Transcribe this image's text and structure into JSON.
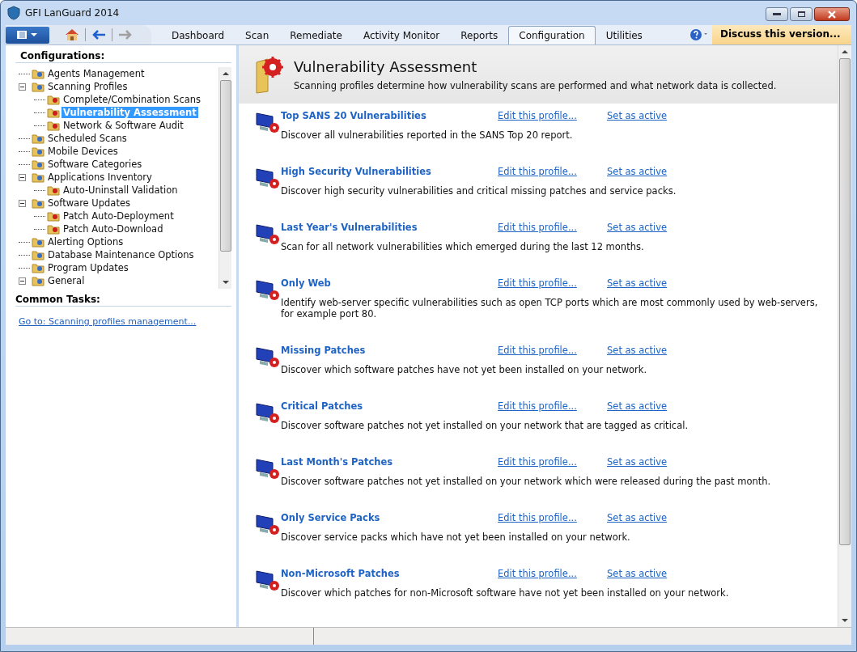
{
  "window": {
    "title": "GFI LanGuard 2014"
  },
  "toolbar": {
    "forward_disabled": true
  },
  "tabs": [
    {
      "label": "Dashboard",
      "selected": false
    },
    {
      "label": "Scan",
      "selected": false
    },
    {
      "label": "Remediate",
      "selected": false
    },
    {
      "label": "Activity Monitor",
      "selected": false
    },
    {
      "label": "Reports",
      "selected": false
    },
    {
      "label": "Configuration",
      "selected": true
    },
    {
      "label": "Utilities",
      "selected": false
    }
  ],
  "discuss_button": "Discuss this version...",
  "sidebar": {
    "title": "Configurations:",
    "tree": [
      {
        "label": "Agents Management",
        "selected": false
      },
      {
        "label": "Scanning Profiles",
        "selected": false,
        "expanded": true,
        "children": [
          {
            "label": "Complete/Combination Scans",
            "selected": false
          },
          {
            "label": "Vulnerability Assessment",
            "selected": true
          },
          {
            "label": "Network & Software Audit",
            "selected": false
          }
        ]
      },
      {
        "label": "Scheduled Scans",
        "selected": false
      },
      {
        "label": "Mobile Devices",
        "selected": false
      },
      {
        "label": "Software Categories",
        "selected": false
      },
      {
        "label": "Applications Inventory",
        "selected": false,
        "expanded": true,
        "children": [
          {
            "label": "Auto-Uninstall Validation",
            "selected": false
          }
        ]
      },
      {
        "label": "Software Updates",
        "selected": false,
        "expanded": true,
        "children": [
          {
            "label": "Patch Auto-Deployment",
            "selected": false
          },
          {
            "label": "Patch Auto-Download",
            "selected": false
          }
        ]
      },
      {
        "label": "Alerting Options",
        "selected": false
      },
      {
        "label": "Database Maintenance Options",
        "selected": false
      },
      {
        "label": "Program Updates",
        "selected": false
      },
      {
        "label": "General",
        "selected": false,
        "expanded": true
      }
    ],
    "tasks_title": "Common Tasks:",
    "tasks": [
      "Go to: Scanning profiles management..."
    ]
  },
  "content": {
    "title": "Vulnerability Assessment",
    "subtitle": "Scanning profiles determine how vulnerability scans are performed and what network data is collected.",
    "profiles": [
      {
        "name": "Top SANS 20 Vulnerabilities",
        "edit": "Edit this profile...",
        "activate": "Set as active",
        "description": "Discover all vulnerabilities reported in the SANS Top 20 report."
      },
      {
        "name": "High Security Vulnerabilities",
        "edit": "Edit this profile...",
        "activate": "Set as active",
        "description": "Discover high security vulnerabilities and critical missing patches and service packs."
      },
      {
        "name": "Last Year's Vulnerabilities",
        "edit": "Edit this profile...",
        "activate": "Set as active",
        "description": "Scan for all network vulnerabilities which emerged during the last 12 months."
      },
      {
        "name": "Only Web",
        "edit": "Edit this profile...",
        "activate": "Set as active",
        "description": "Identify web-server specific vulnerabilities such as open TCP ports which are most commonly used by web-servers, for example port 80."
      },
      {
        "name": "Missing Patches",
        "edit": "Edit this profile...",
        "activate": "Set as active",
        "description": "Discover which software patches have not yet been installed on your network."
      },
      {
        "name": "Critical Patches",
        "edit": "Edit this profile...",
        "activate": "Set as active",
        "description": "Discover software patches not yet installed on your network that are tagged as critical."
      },
      {
        "name": "Last Month's Patches",
        "edit": "Edit this profile...",
        "activate": "Set as active",
        "description": "Discover software patches not yet installed on your network which were released during the past month."
      },
      {
        "name": "Only Service Packs",
        "edit": "Edit this profile...",
        "activate": "Set as active",
        "description": "Discover service packs which have not yet been installed on your network."
      },
      {
        "name": "Non-Microsoft Patches",
        "edit": "Edit this profile...",
        "activate": "Set as active",
        "description": "Discover which patches for non-Microsoft software have not yet been installed on your network."
      }
    ]
  }
}
